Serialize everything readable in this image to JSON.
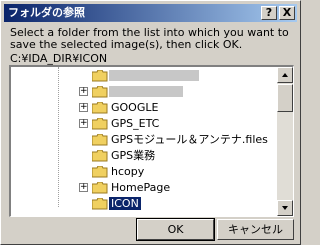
{
  "window": {
    "title": "フォルダの参照",
    "help_label": "?",
    "close_label": "X"
  },
  "instructions": "Select a folder from the list into which you want to save the selected image(s), then click OK.",
  "current_path": "C:¥IDA_DIR¥ICON",
  "tree": {
    "items": [
      {
        "label": "",
        "has_expander": false,
        "blurred": true,
        "selected": false
      },
      {
        "label": "",
        "has_expander": true,
        "blurred": true,
        "selected": false
      },
      {
        "label": "GOOGLE",
        "has_expander": true,
        "blurred": false,
        "selected": false
      },
      {
        "label": "GPS_ETC",
        "has_expander": true,
        "blurred": false,
        "selected": false
      },
      {
        "label": "GPSモジュール＆アンテナ.files",
        "has_expander": false,
        "blurred": false,
        "selected": false
      },
      {
        "label": "GPS業務",
        "has_expander": false,
        "blurred": false,
        "selected": false
      },
      {
        "label": "hcopy",
        "has_expander": false,
        "blurred": false,
        "selected": false
      },
      {
        "label": "HomePage",
        "has_expander": true,
        "blurred": false,
        "selected": false
      },
      {
        "label": "ICON",
        "has_expander": false,
        "blurred": false,
        "selected": true
      }
    ]
  },
  "buttons": {
    "ok_label": "OK",
    "cancel_label": "キャンセル"
  },
  "colors": {
    "title_bar": "#0a246a",
    "selection": "#0a246a",
    "folder": "#f0d060",
    "dialog_face": "#d4d0c8"
  }
}
